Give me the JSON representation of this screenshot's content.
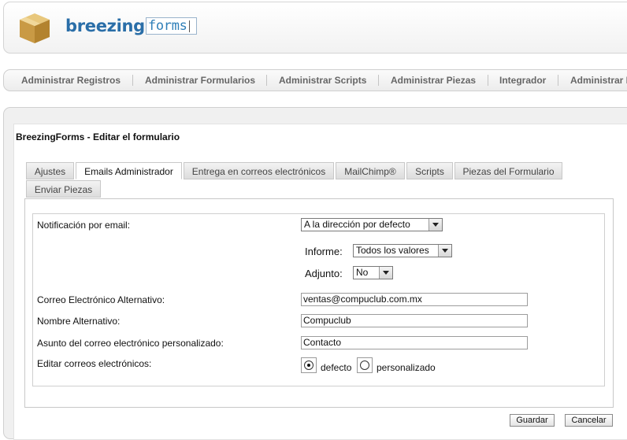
{
  "brand": {
    "name_bold": "breezing",
    "name_box": "forms"
  },
  "nav": {
    "items": [
      "Administrar Registros",
      "Administrar Formularios",
      "Administrar Scripts",
      "Administrar Piezas",
      "Integrador",
      "Administrar P"
    ]
  },
  "page": {
    "title": "BreezingForms - Editar el formulario"
  },
  "tabs": [
    "Ajustes",
    "Emails Administrador",
    "Entrega en correos electrónicos",
    "MailChimp®",
    "Scripts",
    "Piezas del Formulario",
    "Enviar Piezas"
  ],
  "active_tab": "Emails Administrador",
  "form": {
    "notif_label": "Notificación por email:",
    "notif_value": "A la dirección por defecto",
    "informe_label": "Informe:",
    "informe_value": "Todos los valores",
    "adjunto_label": "Adjunto:",
    "adjunto_value": "No",
    "alt_email_label": "Correo Electrónico Alternativo:",
    "alt_email_value": "ventas@compuclub.com.mx",
    "alt_name_label": "Nombre Alternativo:",
    "alt_name_value": "Compuclub",
    "subject_label": "Asunto del correo electrónico personalizado:",
    "subject_value": "Contacto",
    "edit_label": "Editar correos electrónicos:",
    "radio_default": "defecto",
    "radio_custom": "personalizado",
    "selected_radio": "defecto"
  },
  "buttons": {
    "save": "Guardar",
    "cancel": "Cancelar"
  }
}
